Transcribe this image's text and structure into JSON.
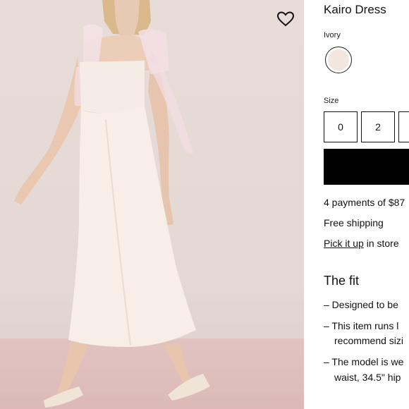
{
  "product": {
    "title": "Kairo Dress",
    "color_label": "Ivory",
    "swatch_color": "#f3e6e1",
    "size_label": "Size",
    "sizes": [
      "0",
      "2",
      ""
    ],
    "installments": "4 payments of $87",
    "shipping": "Free shipping",
    "pickup_link": "Pick it up",
    "pickup_rest": " in store"
  },
  "fit": {
    "title": "The fit",
    "bullets": [
      {
        "line1": "– Designed to be",
        "line2": ""
      },
      {
        "line1": "– This item runs l",
        "line2": "recommend sizi"
      },
      {
        "line1": "– The model is we",
        "line2": "waist, 34.5\" hip"
      }
    ]
  },
  "icons": {
    "favorite": "heart-icon"
  }
}
